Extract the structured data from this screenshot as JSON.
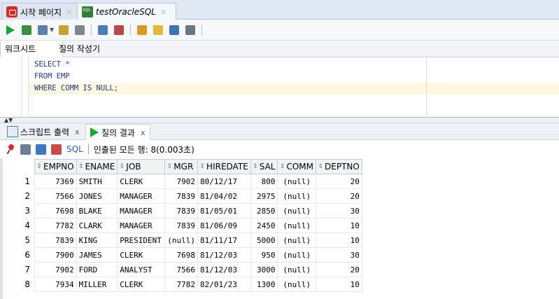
{
  "tabs": [
    {
      "label": "시작 페이지",
      "icon": "oracle-start-icon",
      "active": false
    },
    {
      "label": "testOracleSQL",
      "icon": "database-connection-icon",
      "active": true
    }
  ],
  "toolbar": {
    "icons": [
      "run-statement-icon",
      "run-script-icon",
      "commit-icon",
      "rollback-icon",
      "explain-plan-icon",
      "autotrace-icon",
      "clear-icon",
      "sql-history-icon",
      "format-icon",
      "unshared-worksheet-icon",
      "find-icon"
    ]
  },
  "worksheet_tabs": {
    "worksheet": "워크시트",
    "query_builder": "질의 작성기"
  },
  "editor": {
    "lines": [
      "SELECT *",
      "FROM EMP",
      "WHERE COMM IS NULL;"
    ]
  },
  "result_tabs": {
    "script_output": "스크립트 출력",
    "query_result": "질의 결과",
    "close": "x"
  },
  "result_toolbar": {
    "sql_label": "SQL",
    "status": "인출된 모든 행: 8(0.003초)"
  },
  "grid": {
    "columns": [
      "EMPNO",
      "ENAME",
      "JOB",
      "MGR",
      "HIREDATE",
      "SAL",
      "COMM",
      "DEPTNO"
    ],
    "rows": [
      {
        "n": "1",
        "cells": [
          "7369",
          "SMITH",
          "CLERK",
          "7902",
          "80/12/17",
          "800",
          "(null)",
          "20"
        ]
      },
      {
        "n": "2",
        "cells": [
          "7566",
          "JONES",
          "MANAGER",
          "7839",
          "81/04/02",
          "2975",
          "(null)",
          "20"
        ]
      },
      {
        "n": "3",
        "cells": [
          "7698",
          "BLAKE",
          "MANAGER",
          "7839",
          "81/05/01",
          "2850",
          "(null)",
          "30"
        ]
      },
      {
        "n": "4",
        "cells": [
          "7782",
          "CLARK",
          "MANAGER",
          "7839",
          "81/06/09",
          "2450",
          "(null)",
          "10"
        ]
      },
      {
        "n": "5",
        "cells": [
          "7839",
          "KING",
          "PRESIDENT",
          "(null)",
          "81/11/17",
          "5000",
          "(null)",
          "10"
        ]
      },
      {
        "n": "6",
        "cells": [
          "7900",
          "JAMES",
          "CLERK",
          "7698",
          "81/12/03",
          "950",
          "(null)",
          "30"
        ]
      },
      {
        "n": "7",
        "cells": [
          "7902",
          "FORD",
          "ANALYST",
          "7566",
          "81/12/03",
          "3000",
          "(null)",
          "20"
        ]
      },
      {
        "n": "8",
        "cells": [
          "7934",
          "MILLER",
          "CLERK",
          "7782",
          "82/01/23",
          "1300",
          "(null)",
          "10"
        ]
      }
    ]
  },
  "colors": {
    "accent": "#1aa631",
    "sql_link": "#2460b5",
    "code": "#1e3a8a"
  }
}
